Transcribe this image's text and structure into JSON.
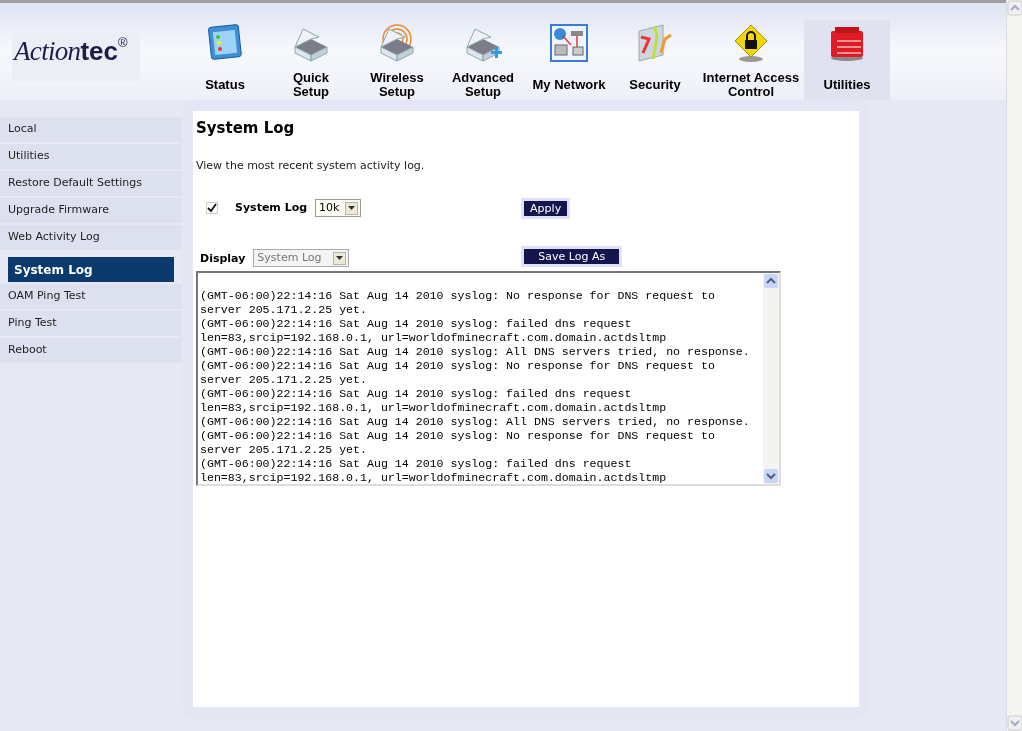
{
  "logo": {
    "script": "Action",
    "bold": "tec",
    "mark": "®"
  },
  "nav": [
    {
      "label": "Status",
      "selected": false
    },
    {
      "label": "Quick Setup",
      "selected": false
    },
    {
      "label": "Wireless Setup",
      "selected": false
    },
    {
      "label": "Advanced Setup",
      "selected": false
    },
    {
      "label": "My Network",
      "selected": false
    },
    {
      "label": "Security",
      "selected": false
    },
    {
      "label": "Internet Access Control",
      "selected": false
    },
    {
      "label": "Utilities",
      "selected": true
    }
  ],
  "sidebar": {
    "items": [
      {
        "label": "Local",
        "selected": false
      },
      {
        "label": "Utilities",
        "selected": false
      },
      {
        "label": "Restore Default Settings",
        "selected": false
      },
      {
        "label": "Upgrade Firmware",
        "selected": false
      },
      {
        "label": "Web Activity Log",
        "selected": false
      },
      {
        "label": "System Log",
        "selected": true
      },
      {
        "label": "OAM Ping Test",
        "selected": false
      },
      {
        "label": "Ping Test",
        "selected": false
      },
      {
        "label": "Reboot",
        "selected": false
      }
    ]
  },
  "page": {
    "title": "System Log",
    "description": "View the most recent system activity log.",
    "log_enable": {
      "label": "System Log",
      "checked": true,
      "size": "10k"
    },
    "apply_button": "Apply",
    "display": {
      "label": "Display",
      "value": "System Log",
      "disabled": true
    },
    "save_button": "Save Log As",
    "log_lines": [
      "(GMT-06:00)22:14:16 Sat Aug 14 2010 syslog: No response for DNS request to",
      "server 205.171.2.25 yet.",
      "(GMT-06:00)22:14:16 Sat Aug 14 2010 syslog: failed dns request",
      "len=83,srcip=192.168.0.1, url=worldofminecraft.com.domain.actdsltmp",
      "(GMT-06:00)22:14:16 Sat Aug 14 2010 syslog: All DNS servers tried, no response.",
      "(GMT-06:00)22:14:16 Sat Aug 14 2010 syslog: No response for DNS request to",
      "server 205.171.2.25 yet.",
      "(GMT-06:00)22:14:16 Sat Aug 14 2010 syslog: failed dns request",
      "len=83,srcip=192.168.0.1, url=worldofminecraft.com.domain.actdsltmp",
      "(GMT-06:00)22:14:16 Sat Aug 14 2010 syslog: All DNS servers tried, no response.",
      "(GMT-06:00)22:14:16 Sat Aug 14 2010 syslog: No response for DNS request to",
      "server 205.171.2.25 yet.",
      "(GMT-06:00)22:14:16 Sat Aug 14 2010 syslog: failed dns request",
      "len=83,srcip=192.168.0.1, url=worldofminecraft.com.domain.actdsltmp"
    ]
  }
}
